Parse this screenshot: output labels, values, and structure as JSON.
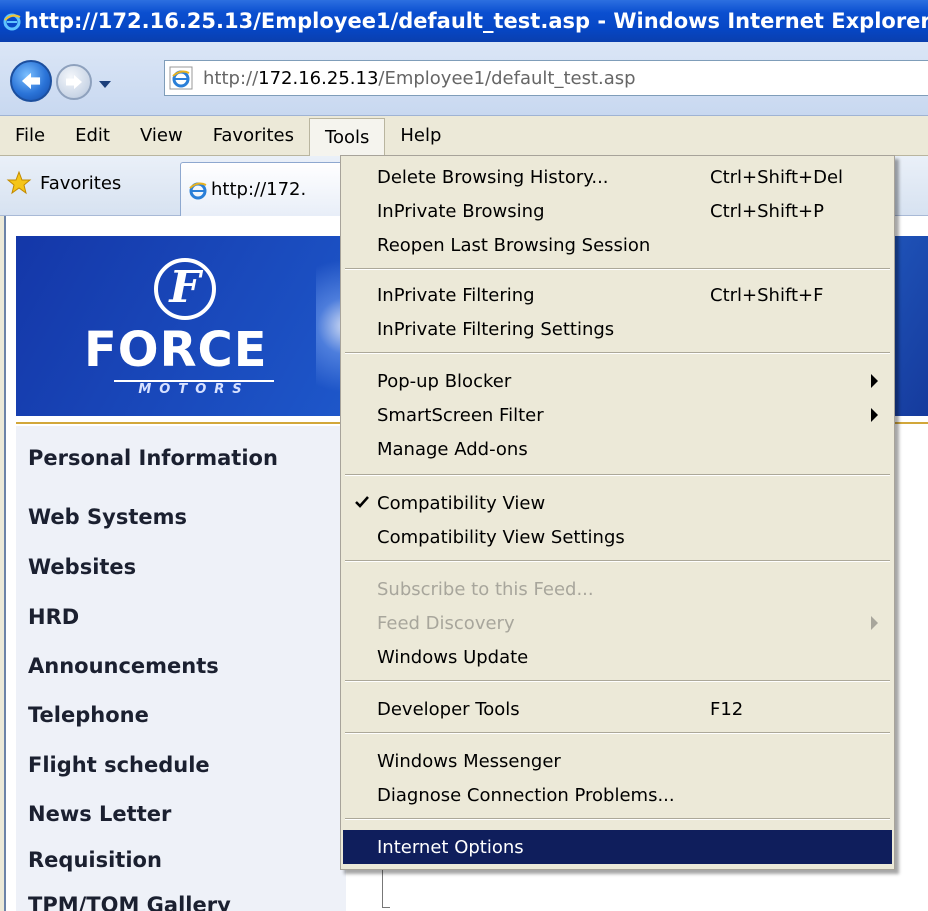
{
  "window": {
    "title": "http://172.16.25.13/Employee1/default_test.asp - Windows Internet Explorer"
  },
  "address_bar": {
    "prefix": "http://",
    "host": "172.16.25.13",
    "path": "/Employee1/default_test.asp"
  },
  "menubar": {
    "items": [
      "File",
      "Edit",
      "View",
      "Favorites",
      "Tools",
      "Help"
    ],
    "active": "Tools"
  },
  "favorites_bar": {
    "favorites_label": "Favorites",
    "tab_label": "http://172."
  },
  "logo": {
    "emblem": "F",
    "name": "FORCE",
    "tagline": "MOTORS"
  },
  "sidenav": {
    "items": [
      "Personal Information",
      "Web Systems",
      "Websites",
      "HRD",
      "Announcements",
      "Telephone",
      "Flight schedule",
      "News Letter",
      "Requisition",
      "TPM/TQM Gallery"
    ]
  },
  "tools_menu": {
    "items": [
      {
        "label": "Delete Browsing History...",
        "shortcut": "Ctrl+Shift+Del"
      },
      {
        "label": "InPrivate Browsing",
        "shortcut": "Ctrl+Shift+P"
      },
      {
        "label": "Reopen Last Browsing Session",
        "shortcut": ""
      },
      {
        "label": "InPrivate Filtering",
        "shortcut": "Ctrl+Shift+F"
      },
      {
        "label": "InPrivate Filtering Settings",
        "shortcut": ""
      },
      {
        "label": "Pop-up Blocker",
        "shortcut": "",
        "submenu": true
      },
      {
        "label": "SmartScreen Filter",
        "shortcut": "",
        "submenu": true
      },
      {
        "label": "Manage Add-ons",
        "shortcut": ""
      },
      {
        "label": "Compatibility View",
        "shortcut": "",
        "checked": true
      },
      {
        "label": "Compatibility View Settings",
        "shortcut": ""
      },
      {
        "label": "Subscribe to this Feed...",
        "shortcut": "",
        "disabled": true
      },
      {
        "label": "Feed Discovery",
        "shortcut": "",
        "disabled": true,
        "submenu": true
      },
      {
        "label": "Windows Update",
        "shortcut": ""
      },
      {
        "label": "Developer Tools",
        "shortcut": "F12"
      },
      {
        "label": "Windows Messenger",
        "shortcut": ""
      },
      {
        "label": "Diagnose Connection Problems...",
        "shortcut": ""
      },
      {
        "label": "Internet Options",
        "shortcut": "",
        "highlighted": true
      }
    ]
  },
  "colors": {
    "titlebar": "#0b4fd0",
    "menu_highlight": "#0f1e5c",
    "banner": "#1d55c8",
    "accent_rule": "#d2a73a"
  }
}
